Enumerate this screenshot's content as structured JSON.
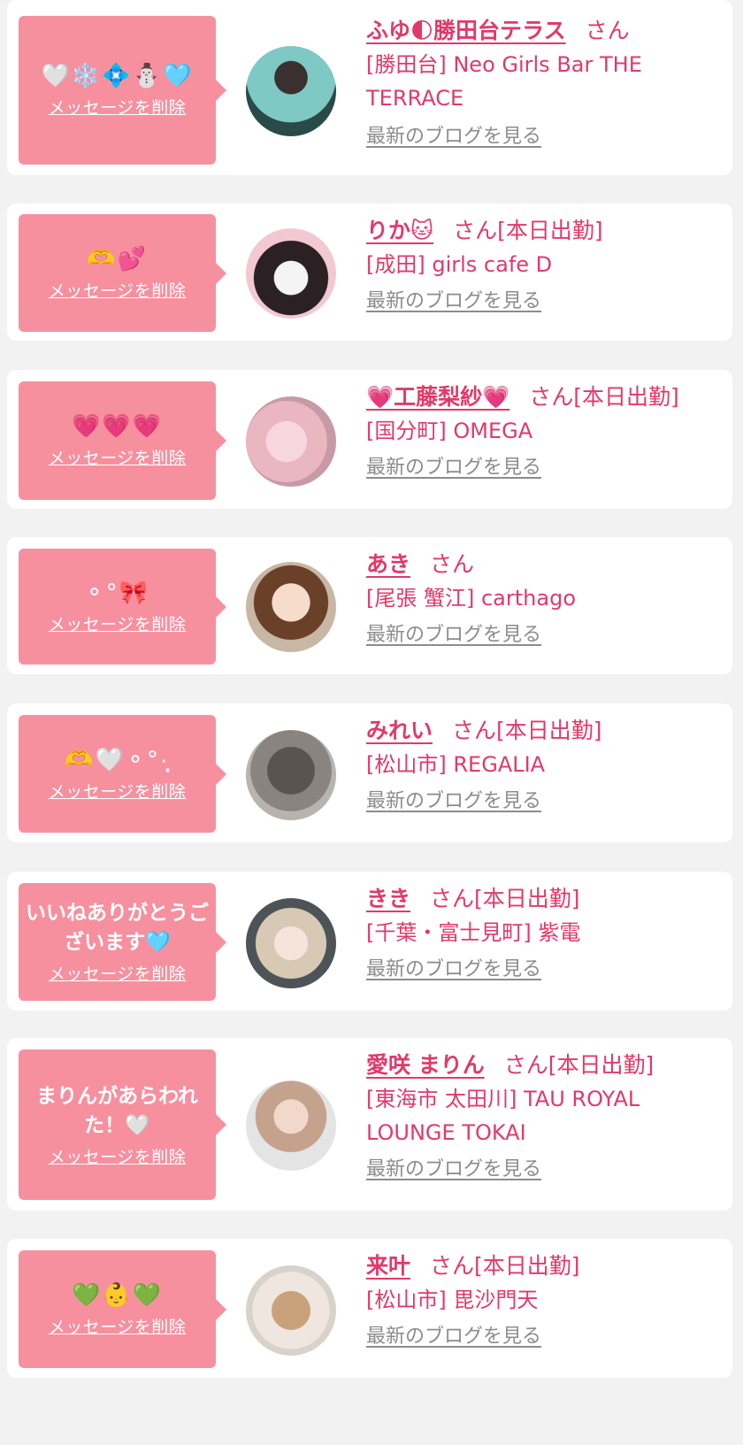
{
  "delete_label": "メッセージを削除",
  "blog_label": "最新のブログを見る",
  "san_label": "さん",
  "entries": [
    {
      "message": "🤍❄️💠⛄🩵",
      "name": "ふゆ🌓勝田台テラス",
      "status": "",
      "shop": "[勝田台] Neo Girls Bar THE TERRACE"
    },
    {
      "message": "🫶💕",
      "name": "りか🐱",
      "status": "[本日出勤]",
      "shop": "[成田] girls cafe D"
    },
    {
      "message": "💗💗💗",
      "name": "💗工藤梨紗💗",
      "status": "[本日出勤]",
      "shop": "[国分町] OMEGA"
    },
    {
      "message": "⚬°🎀",
      "name": "あき",
      "status": "",
      "shop": "[尾張 蟹江] carthago"
    },
    {
      "message": "🫶🤍⚬°·̩͙",
      "name": "みれい",
      "status": "[本日出勤]",
      "shop": "[松山市] REGALIA"
    },
    {
      "message": "いいねありがとうございます🩵",
      "name": "きき",
      "status": "[本日出勤]",
      "shop": "[千葉・富士見町] 紫電"
    },
    {
      "message": "まりんがあらわれた！🤍",
      "name": "愛咲 まりん",
      "status": "[本日出勤]",
      "shop": "[東海市 太田川] TAU ROYAL LOUNGE TOKAI"
    },
    {
      "message": "💚👶💚",
      "name": "来叶",
      "status": "[本日出勤]",
      "shop": "[松山市] 毘沙門天"
    }
  ],
  "colors": {
    "bubble": "#f6909f",
    "accent": "#e03a6a",
    "link_gray": "#8c8c8c",
    "page_bg": "#f2f2f2"
  }
}
